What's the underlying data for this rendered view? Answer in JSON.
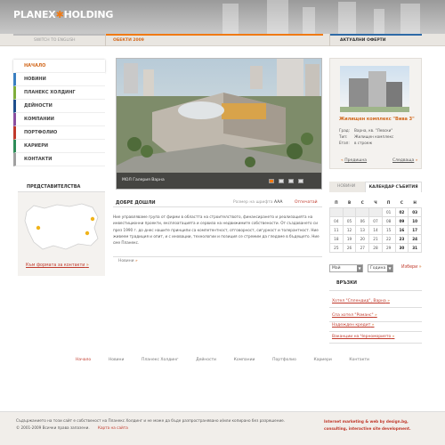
{
  "brand": {
    "logo_left": "PLANEX",
    "logo_star": "✱",
    "logo_right": "HOLDING",
    "accent": "#f07a14"
  },
  "topbar": {
    "switch_lang": "SWITCH TO ENGLISH",
    "offers": "ОБЕКТИ 2009",
    "current_offer": "АКТУАЛНИ ОФЕРТИ"
  },
  "menu": {
    "items": [
      {
        "label": "НАЧАЛО",
        "color": "#ffffff"
      },
      {
        "label": "НОВИНИ",
        "color": "#3a7fc1"
      },
      {
        "label": "ПЛАНЕКС ХОЛДИНГ",
        "color": "#7fae3c"
      },
      {
        "label": "ДЕЙНОСТИ",
        "color": "#1f4e8c"
      },
      {
        "label": "КОМПАНИИ",
        "color": "#8a4fa0"
      },
      {
        "label": "ПОРТФОЛИО",
        "color": "#c0392b"
      },
      {
        "label": "КАРИЕРИ",
        "color": "#2e8b57"
      },
      {
        "label": "КОНТАКТИ",
        "color": "#a0a0a0"
      }
    ]
  },
  "representation": {
    "title": "ПРЕДСТАВИТЕЛСТВА",
    "form_link": "Към формата за контакти"
  },
  "gallery": {
    "caption": "МОЛ Галерия Варна"
  },
  "welcome": {
    "title": "ДОБРЕ ДОШЛИ",
    "font_size_label": "Размер на шрифта",
    "font_size_glyphs": "AAA",
    "print": "Отпечатай",
    "text": "Ние управляваме група от фирми в областта на строителството, финансирането и реализацията на инвестиционни проекти, експлоатацията и сервиза на недвижимите собствености. От създаването си през 1990 г. до днес нашите принципи са компетентност, отговорност, сигурност и толерантност. Ние живеем традиция и опит, и с иновации, технологии и позиция се стремим да гледаме в бъдещето. Ние сме Планекс.",
    "news_link": "Новини"
  },
  "offer": {
    "title": "Жилищен комплекс \"Вива 3\"",
    "rows": [
      {
        "key": "Град:",
        "value": "Варна, кв. \"Левски\""
      },
      {
        "key": "Тип:",
        "value": "Жилищен комплекс"
      },
      {
        "key": "Етап:",
        "value": "в строеж"
      }
    ],
    "prev": "Предишна",
    "next": "Следваща"
  },
  "calendar": {
    "news_tab": "НОВИНИ",
    "tab": "КАЛЕНДАР СЪБИТИЯ",
    "weekdays": [
      "П",
      "В",
      "С",
      "Ч",
      "П",
      "С",
      "Н"
    ],
    "weeks": [
      [
        "",
        "",
        "",
        "",
        "01",
        "02",
        "03"
      ],
      [
        "04",
        "05",
        "06",
        "07",
        "08",
        "09",
        "10"
      ],
      [
        "11",
        "12",
        "13",
        "14",
        "15",
        "16",
        "17"
      ],
      [
        "18",
        "19",
        "20",
        "21",
        "22",
        "23",
        "24"
      ],
      [
        "25",
        "26",
        "27",
        "28",
        "29",
        "30",
        "31"
      ]
    ],
    "month": "Май",
    "year": "Година",
    "choose": "Избери"
  },
  "links": {
    "title": "ВРЪЗКИ",
    "items": [
      "Хотел \"Сплендид\", Варна",
      "Спа хотел \"Романс\"",
      "Надежден кредит",
      "Ваканции на Черноморието"
    ]
  },
  "footer_nav": [
    "Начало",
    "Новини",
    "Планекс Холдинг",
    "Дейности",
    "Компании",
    "Портфолио",
    "Кариери",
    "Контакти"
  ],
  "footer": {
    "copy_note": "Съдържанието на този сайт е собственост на Планекс Холдинг и не може да бъде разпространявано и/или копирано без разрешение.",
    "rights": "© 2001-2009 Всички права запазени.",
    "sitemap": "Карта на сайта",
    "credit": "Internet marketing & web by design.bg, consulting, interactive site development."
  }
}
